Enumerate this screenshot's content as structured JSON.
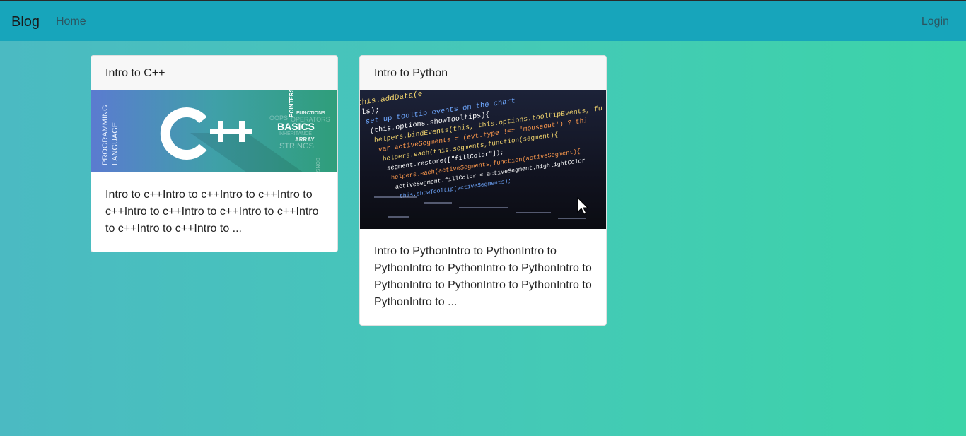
{
  "navbar": {
    "brand": "Blog",
    "home": "Home",
    "login": "Login"
  },
  "posts": [
    {
      "title": "Intro to C++",
      "excerpt": "Intro to c++Intro to c++Intro to c++Intro to c++Intro to c++Intro to c++Intro to c++Intro to c++Intro to c++Intro to ...",
      "image": {
        "logo_text": "C++",
        "side_text": "PROGRAMMING LANGUAGE",
        "word_basics": "BASICS",
        "word_functions": "FUNCTIONS",
        "word_pointers": "POINTERS",
        "word_array": "ARRAY",
        "word_strings": "STRINGS",
        "word_oops": "OOPS",
        "word_operators": "OPERATORS",
        "word_inheritance": "INHERITANCE",
        "word_constructors": "CONSTRUCTORS"
      }
    },
    {
      "title": "Intro to Python",
      "excerpt": "Intro to PythonIntro to PythonIntro to PythonIntro to PythonIntro to PythonIntro to PythonIntro to PythonIntro to PythonIntro to PythonIntro to ...",
      "image": {
        "code_lines": [
          "this.addData(e",
          "ls);",
          "set up tooltip events on the chart",
          "(this.options.showTooltips){",
          "helpers.bindEvents(this, this.options.tooltipEvents, fu",
          "var activeSegments = (evt.type !== 'mouseout') ? thi",
          "helpers.each(this.segments,function(segment){",
          "segment.restore([\"fillColor\"]);",
          "helpers.each(activeSegments,function(activeSegment){",
          "activeSegment.fillColor = activeSegment.highlightColor",
          "this.showTooltip(activeSegments);"
        ]
      }
    }
  ],
  "colors": {
    "navbar": "#17a5bb",
    "cpp_gradient_start": "#5b7bd0",
    "cpp_gradient_end": "#2f9e7a",
    "code_bg": "#12131c"
  }
}
